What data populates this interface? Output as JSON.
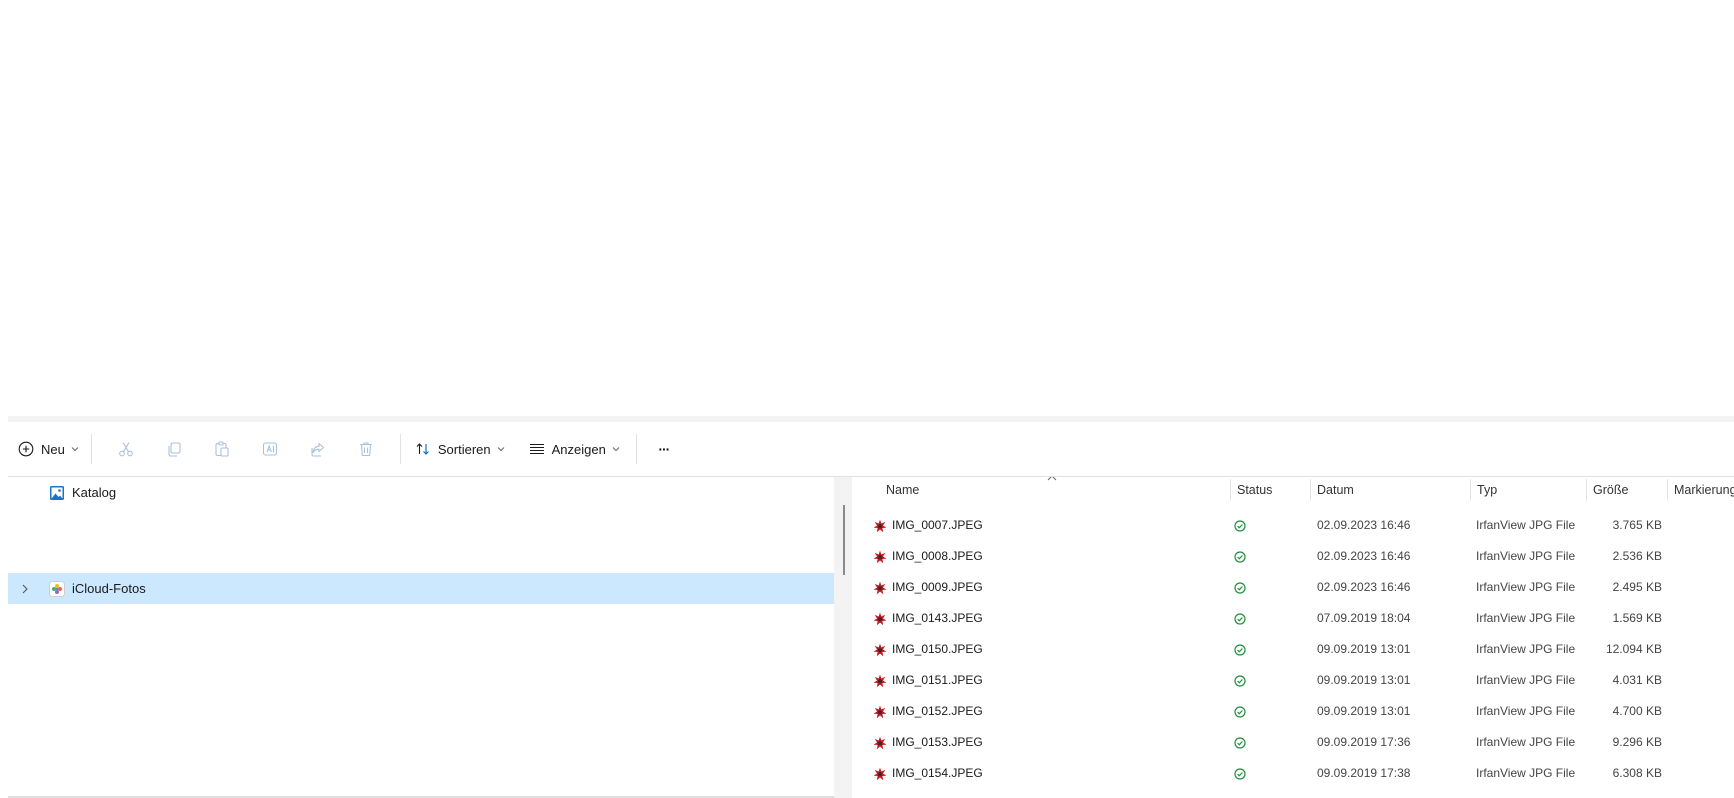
{
  "toolbar": {
    "new_label": "Neu",
    "sort_label": "Sortieren",
    "view_label": "Anzeigen",
    "more_label": "···"
  },
  "nav": {
    "items": [
      {
        "label": "Katalog",
        "icon": "gallery-icon"
      },
      {
        "label": "iCloud-Fotos",
        "icon": "icloud-photos-icon",
        "selected": true
      }
    ]
  },
  "columns": {
    "name": "Name",
    "status": "Status",
    "date": "Datum",
    "type": "Typ",
    "size": "Größe",
    "tags": "Markierung"
  },
  "files": [
    {
      "name": "IMG_0007.JPEG",
      "date": "02.09.2023 16:46",
      "type": "IrfanView JPG File",
      "size": "3.765 KB"
    },
    {
      "name": "IMG_0008.JPEG",
      "date": "02.09.2023 16:46",
      "type": "IrfanView JPG File",
      "size": "2.536 KB"
    },
    {
      "name": "IMG_0009.JPEG",
      "date": "02.09.2023 16:46",
      "type": "IrfanView JPG File",
      "size": "2.495 KB"
    },
    {
      "name": "IMG_0143.JPEG",
      "date": "07.09.2019 18:04",
      "type": "IrfanView JPG File",
      "size": "1.569 KB"
    },
    {
      "name": "IMG_0150.JPEG",
      "date": "09.09.2019 13:01",
      "type": "IrfanView JPG File",
      "size": "12.094 KB"
    },
    {
      "name": "IMG_0151.JPEG",
      "date": "09.09.2019 13:01",
      "type": "IrfanView JPG File",
      "size": "4.031 KB"
    },
    {
      "name": "IMG_0152.JPEG",
      "date": "09.09.2019 13:01",
      "type": "IrfanView JPG File",
      "size": "4.700 KB"
    },
    {
      "name": "IMG_0153.JPEG",
      "date": "09.09.2019 17:36",
      "type": "IrfanView JPG File",
      "size": "9.296 KB"
    },
    {
      "name": "IMG_0154.JPEG",
      "date": "09.09.2019 17:38",
      "type": "IrfanView JPG File",
      "size": "6.308 KB"
    }
  ],
  "colors": {
    "selection": "#cce8ff",
    "status_ok": "#1f8f3a",
    "accent": "#0067c0",
    "irfanview_red": "#c4181f"
  }
}
